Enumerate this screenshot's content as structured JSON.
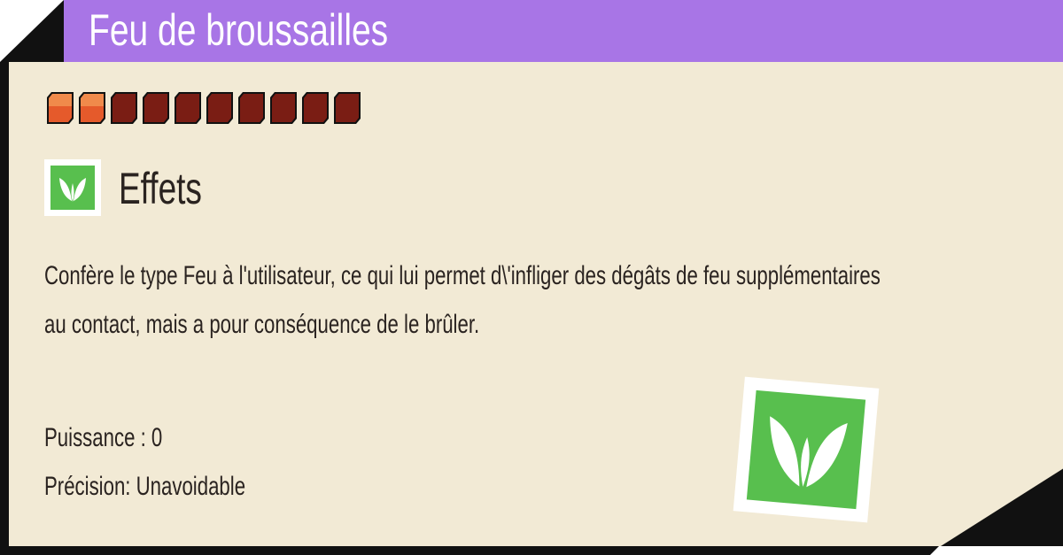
{
  "title": "Feu de broussailles",
  "level": {
    "filled": 2,
    "total": 10
  },
  "colors": {
    "title_bar": "#a875e6",
    "card_bg": "#f2ead5",
    "filled": "#e55a2b",
    "empty": "#7a1d14",
    "effect_icon": "#58bf4e"
  },
  "section": {
    "icon": "leaf-icon",
    "title": "Effets"
  },
  "description": "Confère le type Feu à l'utilisateur, ce qui lui permet d\\'infliger des dégâts de feu supplémentaires au contact, mais a pour conséquence de le brûler.",
  "stats": {
    "power_label": "Puissance : 0",
    "accuracy_label": "Précision: Unavoidable"
  }
}
